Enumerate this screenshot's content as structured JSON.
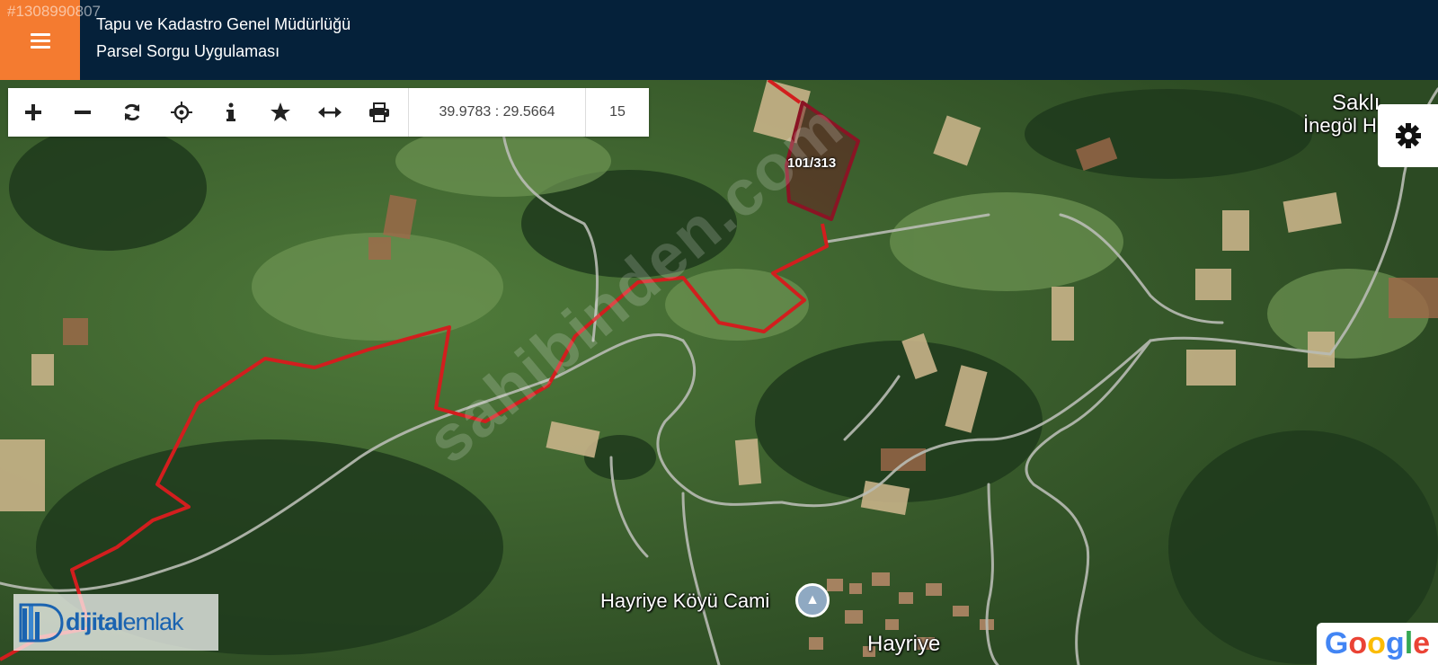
{
  "header": {
    "listing_id": "#1308990807",
    "title_line1": "Tapu ve Kadastro Genel Müdürlüğü",
    "title_line2": "Parsel Sorgu Uygulaması",
    "menu_icon": "hamburger-icon",
    "accent_color": "#f47b30",
    "bg_color": "#05213a"
  },
  "toolbar": {
    "tools": [
      "zoom-in-icon",
      "zoom-out-icon",
      "refresh-icon",
      "locate-icon",
      "info-icon",
      "favorite-icon",
      "measure-icon",
      "print-icon"
    ],
    "coordinates": "39.9783 : 29.5664",
    "zoom_level": "15"
  },
  "settings": {
    "icon": "gear-icon"
  },
  "map": {
    "parcel_label": "101/313",
    "place_labels": {
      "top_right_1": "Saklı ...",
      "top_right_2": "İnegöl H...",
      "mosque": "Hayriye Köyü Cami",
      "village": "Hayriye"
    },
    "watermark": "sahibinden.com",
    "boundary_color": "#d21e1e",
    "parcel_color": "#8a1424"
  },
  "branding": {
    "dijital_prefix": "dijital",
    "dijital_suffix": "emlak",
    "google": "Google"
  }
}
